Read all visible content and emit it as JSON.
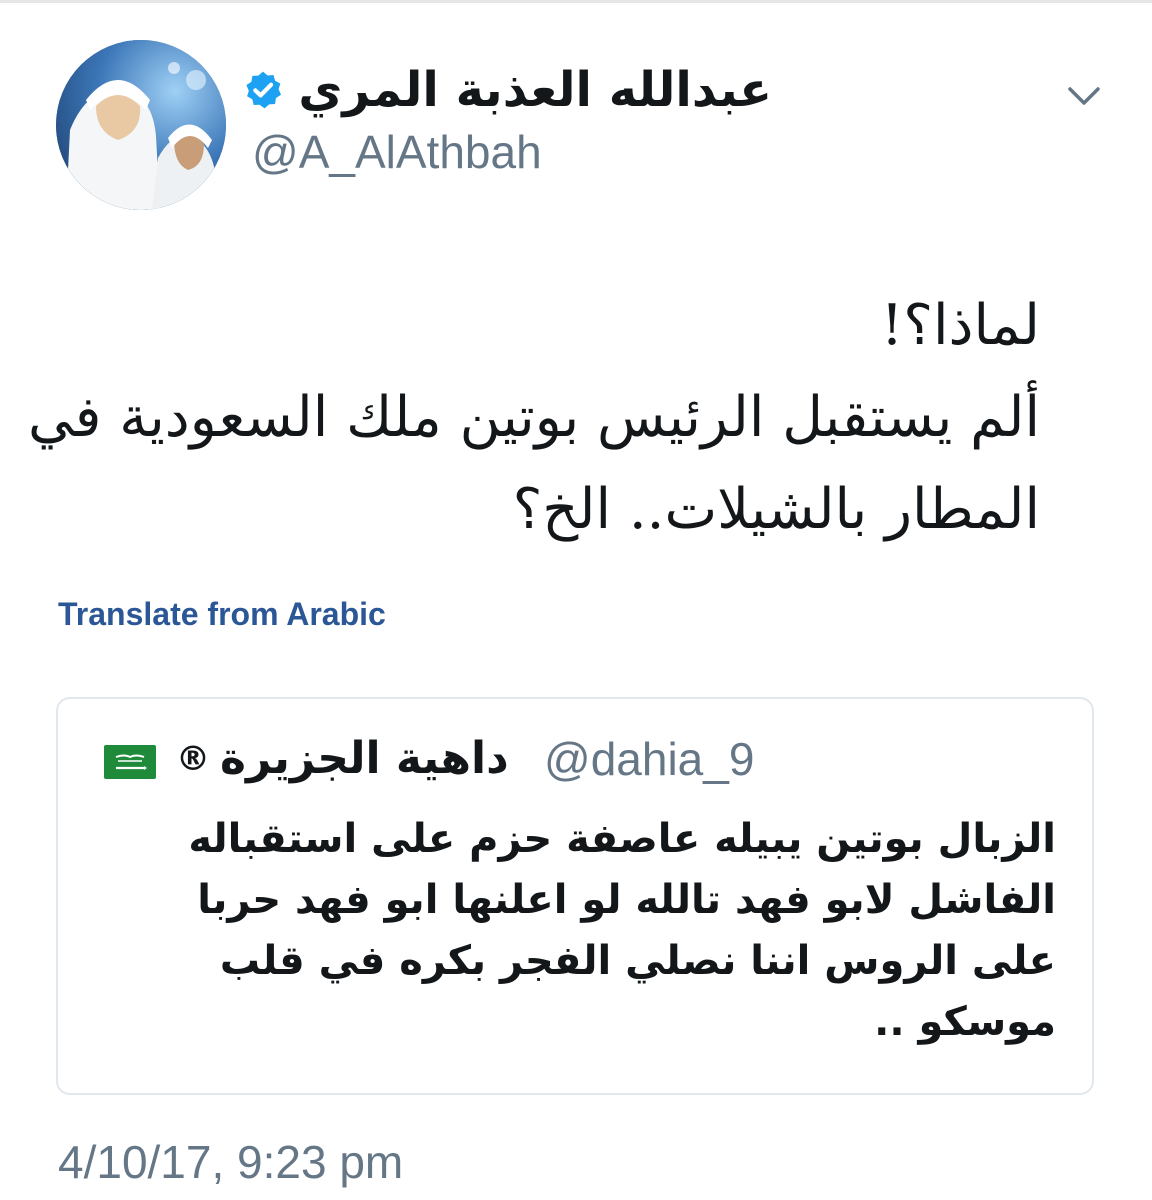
{
  "tweet": {
    "author": {
      "display_name": "عبدالله العذبة المري",
      "handle": "@A_AlAthbah",
      "verified": true,
      "verified_icon": "verified-badge-icon",
      "verified_color": "#1DA1F2"
    },
    "menu_icon": "chevron-down-icon",
    "text_lines": [
      "لماذا؟!",
      "ألم يستقبل الرئيس بوتين ملك السعودية في",
      "المطار بالشيلات.. الخ؟"
    ],
    "translate_label": "Translate from Arabic",
    "quoted": {
      "display_name": "داهية الجزيرة",
      "registered_mark": "®",
      "flag_icon": "saudi-flag-icon",
      "handle": "@dahia_9",
      "text_lines": [
        "الزبال بوتين يبيله عاصفة حزم على استقباله",
        "الفاشل لابو فهد تالله لو اعلنها ابو فهد حربا",
        "على الروس اننا نصلي الفجر بكره في قلب",
        "موسكو .."
      ]
    },
    "timestamp": "4/10/17, 9:23 pm"
  },
  "colors": {
    "link": "#2B5797",
    "secondary_text": "#657786",
    "primary_text": "#14171A",
    "card_border": "#E1E8ED",
    "flag_green": "#1E8A3A"
  }
}
